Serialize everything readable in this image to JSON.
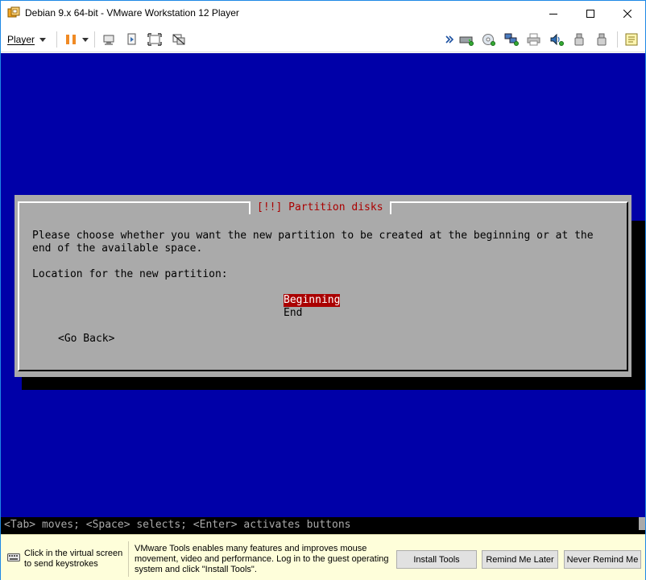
{
  "window": {
    "title": "Debian 9.x 64-bit - VMware Workstation 12 Player"
  },
  "toolbar": {
    "player_label": "Player",
    "icons": [
      "pause-icon",
      "send-ctrl-alt-del-icon",
      "fit-guest-icon",
      "fullscreen-icon",
      "unity-icon",
      "double-chevron-icon",
      "hard-disk-icon",
      "cd-dvd-icon",
      "network-adapter-icon",
      "printer-icon",
      "sound-card-icon",
      "usb-device-icon",
      "usb-device-2-icon",
      "message-log-icon"
    ]
  },
  "guest": {
    "dialog_title": "[!!] Partition disks",
    "prompt_line1": "Please choose whether you want the new partition to be created at the beginning or at the",
    "prompt_line2": "end of the available space.",
    "location_label": "Location for the new partition:",
    "options": [
      "Beginning",
      "End"
    ],
    "selected_option": "Beginning",
    "go_back": "<Go Back>",
    "status_line": "<Tab> moves; <Space> selects; <Enter> activates buttons",
    "colors": {
      "background": "#0000a8",
      "dialog": "#aaaaaa",
      "title_text": "#aa0000",
      "highlight": "#aa0000"
    }
  },
  "notification": {
    "keyboard_hint": "Click in the virtual screen to send keystrokes",
    "tools_message": "VMware Tools enables many features and improves mouse movement, video and performance. Log in to the guest operating system and click \"Install Tools\".",
    "install_button": "Install Tools",
    "remind_button": "Remind Me Later",
    "never_button": "Never Remind Me"
  }
}
